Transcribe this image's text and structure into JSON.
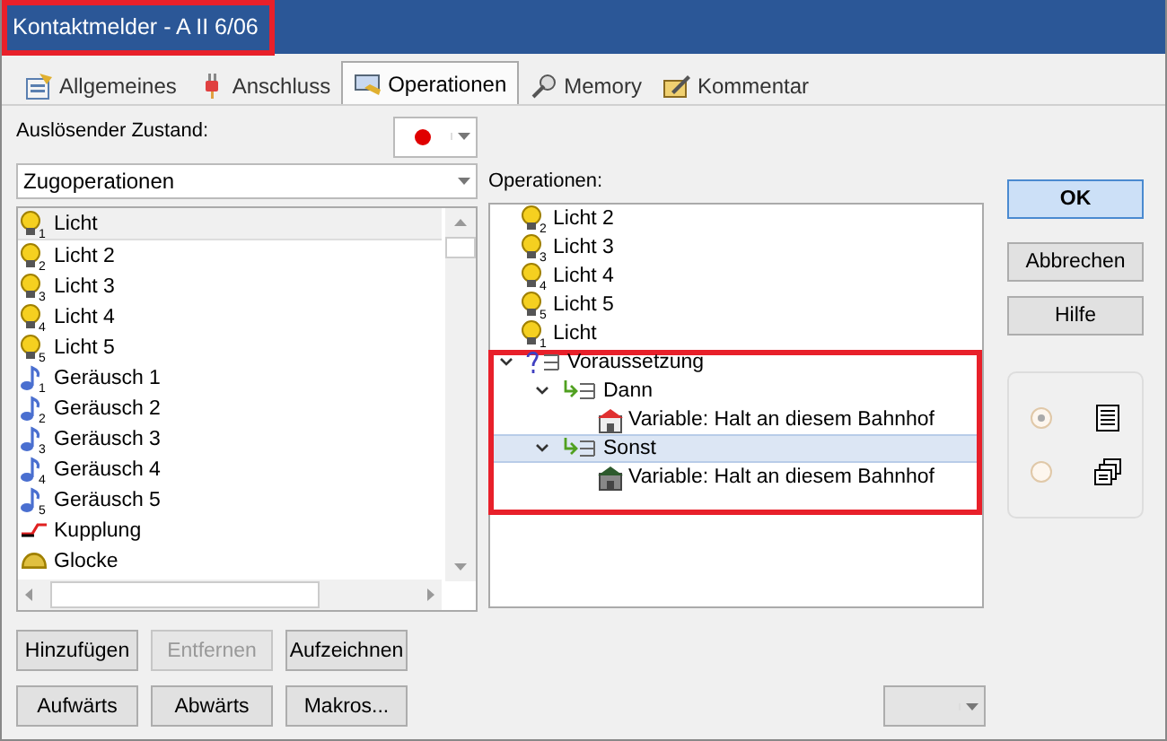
{
  "window": {
    "title": "Kontaktmelder - A II 6/06"
  },
  "tabs": [
    {
      "label": "Allgemeines",
      "selected": false
    },
    {
      "label": "Anschluss",
      "selected": false
    },
    {
      "label": "Operationen",
      "selected": true
    },
    {
      "label": "Memory",
      "selected": false
    },
    {
      "label": "Kommentar",
      "selected": false
    }
  ],
  "trigger": {
    "label": "Auslösender Zustand:",
    "color": "#e00000"
  },
  "category": {
    "value": "Zugoperationen"
  },
  "available": [
    {
      "label": "Licht",
      "kind": "light",
      "badge": "1",
      "selected": true
    },
    {
      "label": "Licht 2",
      "kind": "light",
      "badge": "2",
      "selected": false
    },
    {
      "label": "Licht 3",
      "kind": "light",
      "badge": "3",
      "selected": false
    },
    {
      "label": "Licht 4",
      "kind": "light",
      "badge": "4",
      "selected": false
    },
    {
      "label": "Licht 5",
      "kind": "light",
      "badge": "5",
      "selected": false
    },
    {
      "label": "Geräusch 1",
      "kind": "sound",
      "badge": "1",
      "selected": false
    },
    {
      "label": "Geräusch 2",
      "kind": "sound",
      "badge": "2",
      "selected": false
    },
    {
      "label": "Geräusch 3",
      "kind": "sound",
      "badge": "3",
      "selected": false
    },
    {
      "label": "Geräusch 4",
      "kind": "sound",
      "badge": "4",
      "selected": false
    },
    {
      "label": "Geräusch 5",
      "kind": "sound",
      "badge": "5",
      "selected": false
    },
    {
      "label": "Kupplung",
      "kind": "coupling",
      "selected": false
    },
    {
      "label": "Glocke",
      "kind": "bell",
      "selected": false
    }
  ],
  "operations_label": "Operationen:",
  "operations": [
    {
      "label": "Licht 2",
      "kind": "light",
      "badge": "2",
      "selected": false
    },
    {
      "label": "Licht 3",
      "kind": "light",
      "badge": "3",
      "selected": false
    },
    {
      "label": "Licht 4",
      "kind": "light",
      "badge": "4",
      "selected": false
    },
    {
      "label": "Licht 5",
      "kind": "light",
      "badge": "5",
      "selected": false
    },
    {
      "label": "Licht",
      "kind": "light",
      "badge": "1",
      "selected": false
    },
    {
      "label": "Voraussetzung",
      "kind": "condition",
      "expanded": true,
      "selected": false,
      "children": [
        {
          "label": "Dann",
          "kind": "branch",
          "expanded": true,
          "selected": false,
          "children": [
            {
              "label": "Variable: Halt an diesem Bahnhof",
              "kind": "variable_red",
              "selected": false
            }
          ]
        },
        {
          "label": "Sonst",
          "kind": "branch",
          "expanded": true,
          "selected": true,
          "children": [
            {
              "label": "Variable: Halt an diesem Bahnhof",
              "kind": "variable_green",
              "selected": false
            }
          ]
        }
      ]
    }
  ],
  "side_buttons": [
    {
      "label": "OK",
      "default": true
    },
    {
      "label": "Abbrechen",
      "default": false
    },
    {
      "label": "Hilfe",
      "default": false
    }
  ],
  "view_options": [
    {
      "selected": true,
      "kind": "list"
    },
    {
      "selected": false,
      "kind": "windows"
    }
  ],
  "edit_buttons": [
    {
      "label": "Hinzufügen",
      "disabled": false
    },
    {
      "label": "Entfernen",
      "disabled": true
    },
    {
      "label": "Aufzeichnen",
      "disabled": false
    }
  ],
  "move_buttons": [
    {
      "label": "Aufwärts",
      "disabled": false
    },
    {
      "label": "Abwärts",
      "disabled": false
    },
    {
      "label": "Makros...",
      "disabled": false
    }
  ]
}
